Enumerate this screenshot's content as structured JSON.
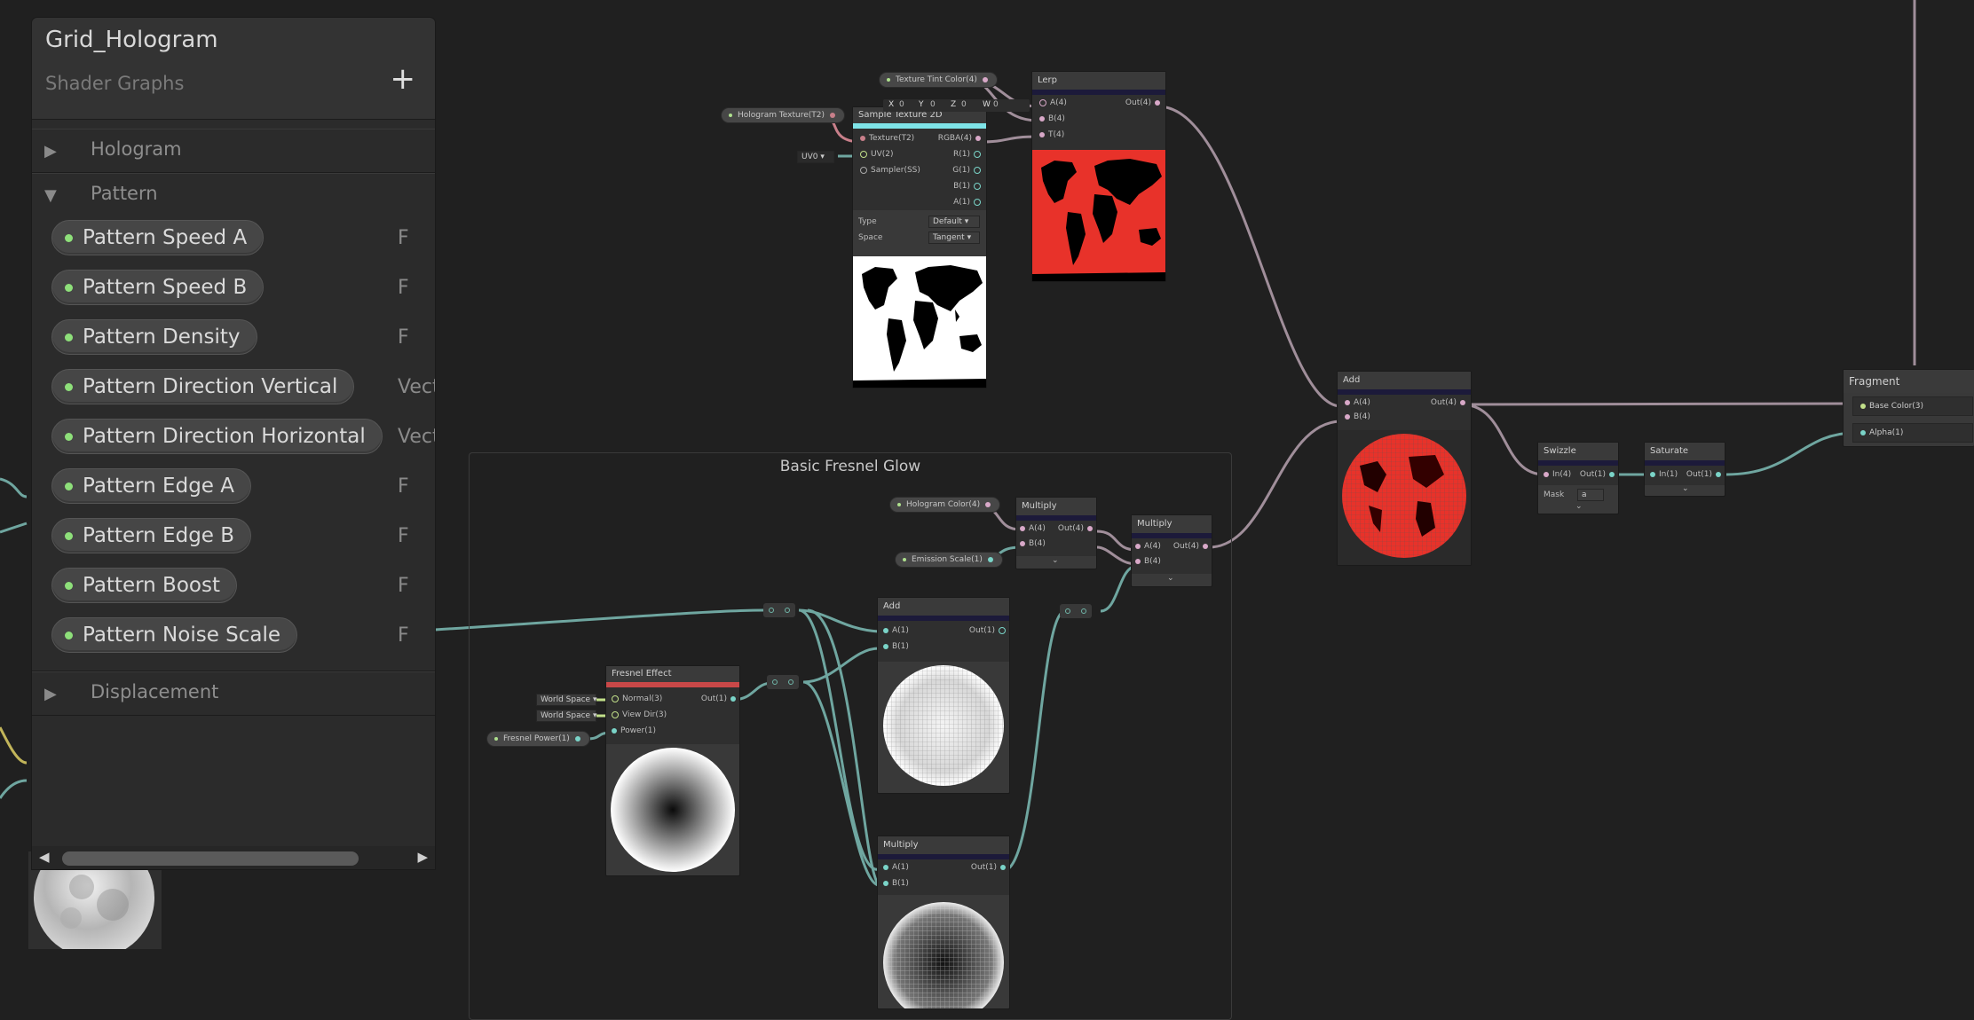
{
  "blackboard": {
    "title": "Grid_Hologram",
    "subtitle": "Shader Graphs",
    "add_label": "+",
    "categories": {
      "hologram": "Hologram",
      "pattern": "Pattern",
      "displacement": "Displacement"
    },
    "properties": [
      {
        "name": "Pattern Speed A",
        "type": "F"
      },
      {
        "name": "Pattern Speed B",
        "type": "F"
      },
      {
        "name": "Pattern Density",
        "type": "F"
      },
      {
        "name": "Pattern Direction Vertical",
        "type": "Vect"
      },
      {
        "name": "Pattern Direction Horizontal",
        "type": "Vect"
      },
      {
        "name": "Pattern Edge A",
        "type": "F"
      },
      {
        "name": "Pattern Edge B",
        "type": "F"
      },
      {
        "name": "Pattern Boost",
        "type": "F"
      },
      {
        "name": "Pattern Noise Scale",
        "type": "F"
      }
    ]
  },
  "group": {
    "title": "Basic Fresnel Glow"
  },
  "nodes": {
    "sample_texture": {
      "title": "Sample Texture 2D",
      "inputs": [
        "Texture(T2)",
        "UV(2)",
        "Sampler(SS)"
      ],
      "outputs": [
        "RGBA(4)",
        "R(1)",
        "G(1)",
        "B(1)",
        "A(1)"
      ],
      "type_label": "Type",
      "type_value": "Default",
      "space_label": "Space",
      "space_value": "Tangent",
      "uv_value": "UV0"
    },
    "lerp": {
      "title": "Lerp",
      "inputs": [
        "A(4)",
        "B(4)",
        "T(4)"
      ],
      "output": "Out(4)",
      "xyzw": [
        "X",
        "0",
        "Y",
        "0",
        "Z",
        "0",
        "W",
        "0"
      ]
    },
    "add_top": {
      "title": "Add",
      "inputs": [
        "A(4)",
        "B(4)"
      ],
      "output": "Out(4)"
    },
    "swizzle": {
      "title": "Swizzle",
      "input": "In(4)",
      "output": "Out(1)",
      "mask_label": "Mask",
      "mask_value": "a"
    },
    "saturate": {
      "title": "Saturate",
      "input": "In(1)",
      "output": "Out(1)"
    },
    "fragment": {
      "title": "Fragment",
      "inputs": [
        "Base Color(3)",
        "Alpha(1)"
      ]
    },
    "multiply_a": {
      "title": "Multiply",
      "inputs": [
        "A(4)",
        "B(4)"
      ],
      "output": "Out(4)"
    },
    "multiply_b": {
      "title": "Multiply",
      "inputs": [
        "A(4)",
        "B(4)"
      ],
      "output": "Out(4)"
    },
    "add_mid": {
      "title": "Add",
      "inputs": [
        "A(1)",
        "B(1)"
      ],
      "output": "Out(1)"
    },
    "multiply_c": {
      "title": "Multiply",
      "inputs": [
        "A(1)",
        "B(1)"
      ],
      "output": "Out(1)"
    },
    "fresnel": {
      "title": "Fresnel Effect",
      "inputs": [
        "Normal(3)",
        "View Dir(3)",
        "Power(1)"
      ],
      "output": "Out(1)",
      "normal_space": "World Space",
      "view_space": "World Space"
    }
  },
  "properties_on_graph": {
    "texture_tint": "Texture Tint Color(4)",
    "hologram_texture": "Hologram Texture(T2)",
    "hologram_color": "Hologram Color(4)",
    "emission_scale": "Emission Scale(1)",
    "fresnel_power": "Fresnel Power(1)"
  },
  "colors": {
    "background": "#202020",
    "wire_color": "#a08e9a",
    "wire_float": "#6fa6a0",
    "red_preview": "#e8322a",
    "texture_header": "#7ee4e8",
    "fresnel_header": "#c94848"
  }
}
